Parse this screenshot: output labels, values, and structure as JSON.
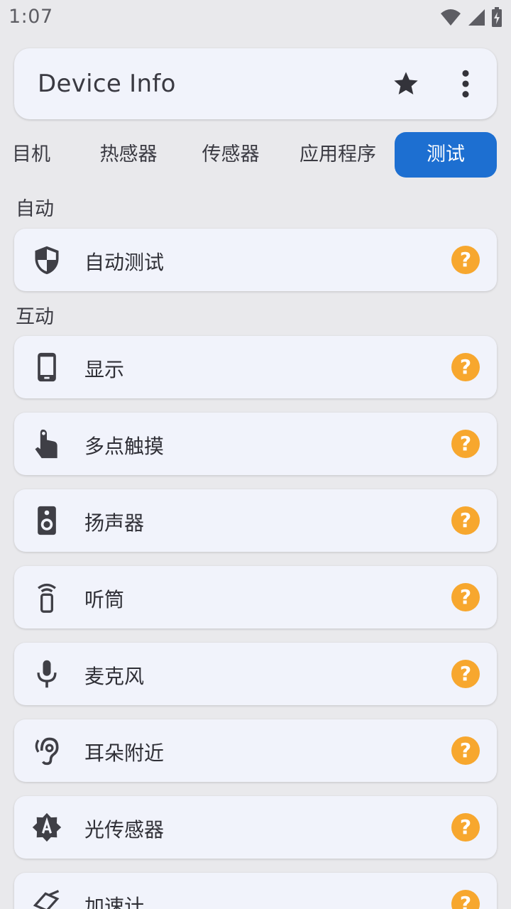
{
  "status": {
    "time": "1:07",
    "icons": [
      "wifi-icon",
      "signal-icon",
      "battery-charging-icon"
    ]
  },
  "app_bar": {
    "title": "Device Info",
    "actions": [
      "star-icon",
      "more-vert-icon"
    ]
  },
  "tabs": [
    {
      "label": "目机",
      "active": false
    },
    {
      "label": "热感器",
      "active": false
    },
    {
      "label": "传感器",
      "active": false
    },
    {
      "label": "应用程序",
      "active": false
    },
    {
      "label": "测试",
      "active": true
    }
  ],
  "sections": {
    "auto": "自动",
    "interactive": "互动"
  },
  "items": [
    {
      "label": "自动测试",
      "icon": "shield-icon"
    },
    {
      "label": "显示",
      "icon": "smartphone-icon"
    },
    {
      "label": "多点触摸",
      "icon": "touch-icon"
    },
    {
      "label": "扬声器",
      "icon": "speaker-icon"
    },
    {
      "label": "听筒",
      "icon": "earpiece-icon"
    },
    {
      "label": "麦克风",
      "icon": "mic-icon"
    },
    {
      "label": "耳朵附近",
      "icon": "ear-icon"
    },
    {
      "label": "光传感器",
      "icon": "brightness-auto-icon"
    },
    {
      "label": "加速计",
      "icon": "accelerometer-icon"
    }
  ],
  "help_glyph": "?",
  "colors": {
    "background": "#e9e9ec",
    "card": "#f1f3fb",
    "active_tab": "#1d6fd1",
    "help_badge": "#f7a72e",
    "icon": "#3f3f46"
  }
}
